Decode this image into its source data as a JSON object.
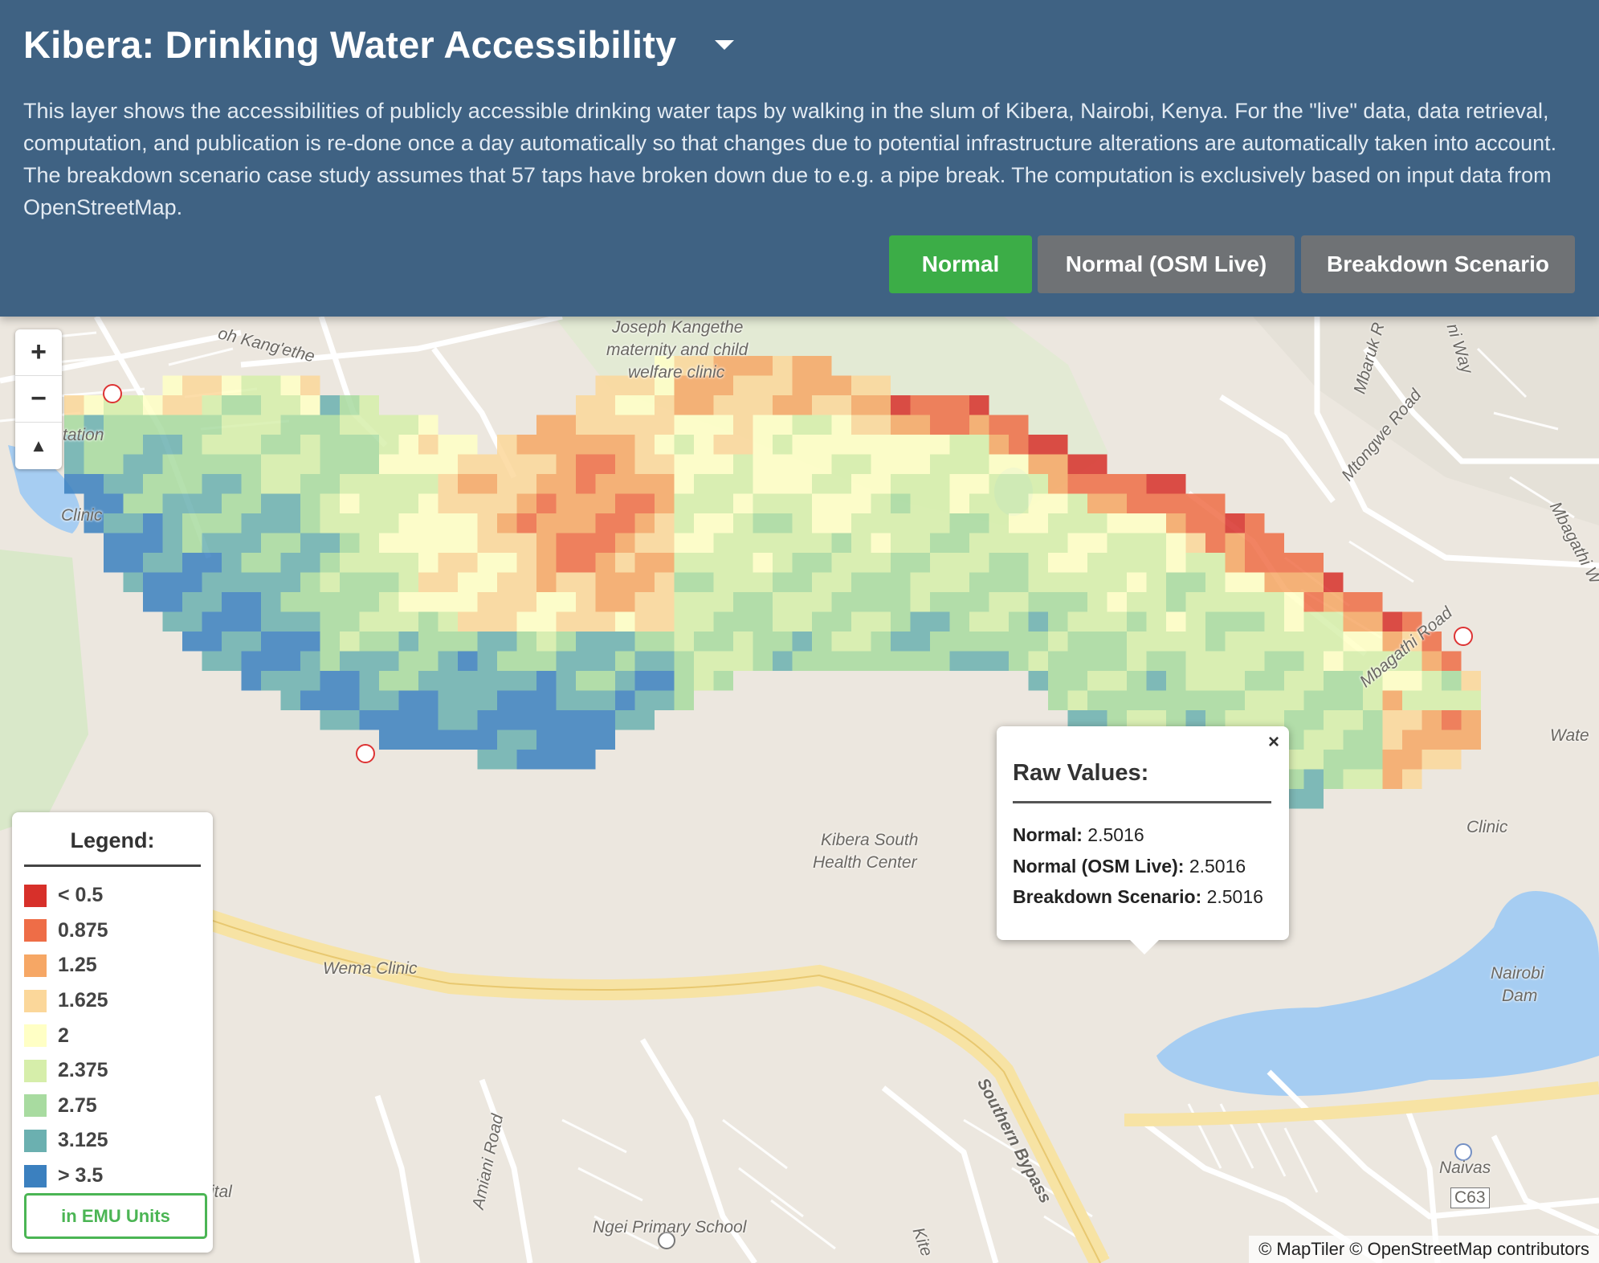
{
  "header": {
    "title": "Kibera: Drinking Water Accessibility",
    "description": "This layer shows the accessibilities of publicly accessible drinking water taps by walking in the slum of Kibera, Nairobi, Kenya. For the \"live\" data, data retrieval, computation, and publication is re-done once a day automatically so that changes due to potential infrastructure alterations are automatically taken into account. The breakdown scenario case study assumes that 57 taps have broken down due to e.g. a pipe break. The computation is exclusively based on input data from OpenStreetMap.",
    "dropdown_icon": "caret-down-icon",
    "buttons": {
      "normal": "Normal",
      "normal_live": "Normal (OSM Live)",
      "breakdown": "Breakdown Scenario"
    },
    "active_color": "#3cad47",
    "inactive_color": "#6f7275"
  },
  "zoom": {
    "in": "+",
    "out": "−",
    "compass": "▲"
  },
  "map_labels": {
    "kangethe": "oh Kang'ethe",
    "joseph": "Joseph Kangethe",
    "maternity": "maternity and child",
    "welfare": "welfare clinic",
    "mbaruk": "Mbaruk R",
    "niway": "ni Way",
    "mtongwe": "Mtongwe Road",
    "mbagathi_road": "Mbagathi Road",
    "mbagathi_way": "Mbagathi W",
    "wate": "Wate",
    "tation": "tation",
    "clinic_left": "Clinic",
    "kibera_south": "Kibera South",
    "health_center": "Health Center",
    "wema": "Wema Clinic",
    "fclinic": "Clinic",
    "nairobi": "Nairobi",
    "dam": "Dam",
    "southern_bypass": "Southern Bypass",
    "amiani": "Amiani Road",
    "ngei": "Ngei Primary School",
    "naivas": "Naivas",
    "c63": "C63",
    "ital": "ital",
    "kit": "Kite"
  },
  "legend": {
    "title": "Legend:",
    "items": [
      {
        "label": "< 0.5",
        "color": "#d7302a"
      },
      {
        "label": "0.875",
        "color": "#ee6d47"
      },
      {
        "label": "1.25",
        "color": "#f6a765"
      },
      {
        "label": "1.625",
        "color": "#fbd79a"
      },
      {
        "label": "2",
        "color": "#ffffc5"
      },
      {
        "label": "2.375",
        "color": "#d6eeaa"
      },
      {
        "label": "2.75",
        "color": "#a8dba0"
      },
      {
        "label": "3.125",
        "color": "#6bb0b0"
      },
      {
        "label": "> 3.5",
        "color": "#3b80bf"
      }
    ],
    "units_button": "in EMU Units"
  },
  "popup": {
    "title": "Raw Values:",
    "close": "×",
    "rows": [
      {
        "key": "Normal:",
        "value": "2.5016"
      },
      {
        "key": "Normal (OSM Live):",
        "value": "2.5016"
      },
      {
        "key": "Breakdown Scenario:",
        "value": "2.5016"
      }
    ]
  },
  "attribution": "© MapTiler © OpenStreetMap contributors"
}
